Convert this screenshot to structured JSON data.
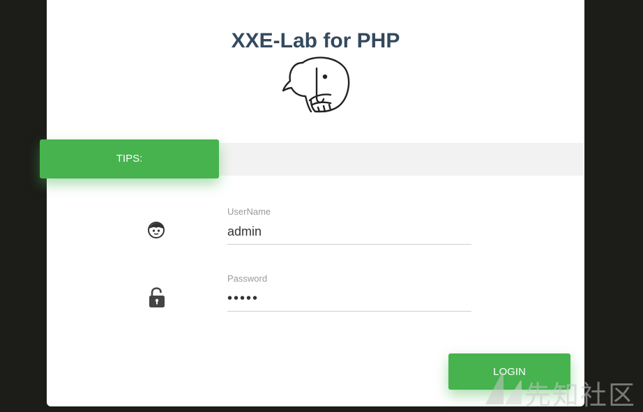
{
  "page": {
    "title": "XXE-Lab for PHP"
  },
  "tips": {
    "label": "TIPS:"
  },
  "form": {
    "username": {
      "label": "UserName",
      "value": "admin"
    },
    "password": {
      "label": "Password",
      "value": "•••••"
    },
    "login_label": "LOGIN"
  },
  "icons": {
    "logo": "elephant-logo-icon",
    "user": "user-face-icon",
    "lock": "unlocked-padlock-icon",
    "watermark": "xianzhi-logo-icon"
  },
  "colors": {
    "accent": "#47b34f",
    "title": "#34495e",
    "background": "#1c1c18"
  },
  "watermark": {
    "text": "先知社区"
  }
}
